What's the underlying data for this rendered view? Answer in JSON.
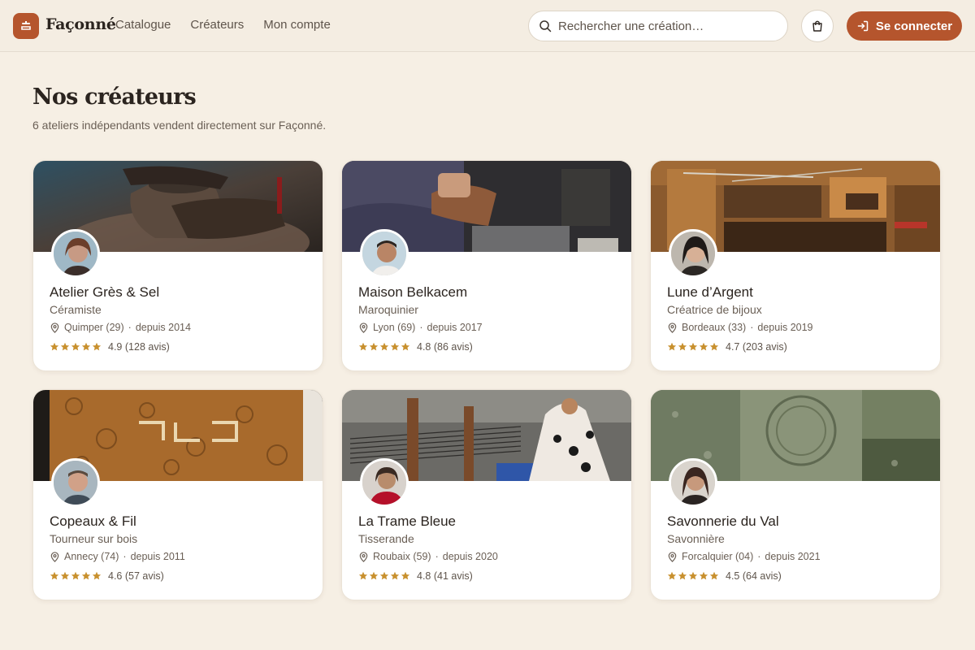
{
  "brand": {
    "name": "Façonné",
    "accent": "#b5552d"
  },
  "nav": [
    {
      "label": "Catalogue"
    },
    {
      "label": "Créateurs"
    },
    {
      "label": "Mon compte"
    }
  ],
  "search": {
    "placeholder": "Rechercher une création…",
    "value": ""
  },
  "header": {
    "cart_icon": "shopping-bag-icon",
    "login_label": "Se connecter",
    "login_icon": "sign-in-icon"
  },
  "page": {
    "title": "Nos créateurs",
    "subtitle": "6 ateliers indépendants vendent directement sur Façonné."
  },
  "creators": [
    {
      "name": "Atelier Grès & Sel",
      "trade": "Céramiste",
      "location": "Quimper (29)",
      "since": "depuis 2014",
      "rating": "4.9",
      "reviews": "(128 avis)",
      "stars": 5
    },
    {
      "name": "Maison Belkacem",
      "trade": "Maroquinier",
      "location": "Lyon (69)",
      "since": "depuis 2017",
      "rating": "4.8",
      "reviews": "(86 avis)",
      "stars": 5
    },
    {
      "name": "Lune d’Argent",
      "trade": "Créatrice de bijoux",
      "location": "Bordeaux (33)",
      "since": "depuis 2019",
      "rating": "4.7",
      "reviews": "(203 avis)",
      "stars": 5
    },
    {
      "name": "Copeaux & Fil",
      "trade": "Tourneur sur bois",
      "location": "Annecy (74)",
      "since": "depuis 2011",
      "rating": "4.6",
      "reviews": "(57 avis)",
      "stars": 5
    },
    {
      "name": "La Trame Bleue",
      "trade": "Tisserande",
      "location": "Roubaix (59)",
      "since": "depuis 2020",
      "rating": "4.8",
      "reviews": "(41 avis)",
      "stars": 5
    },
    {
      "name": "Savonnerie du Val",
      "trade": "Savonnière",
      "location": "Forcalquier (04)",
      "since": "depuis 2021",
      "rating": "4.5",
      "reviews": "(64 avis)",
      "stars": 5
    }
  ]
}
